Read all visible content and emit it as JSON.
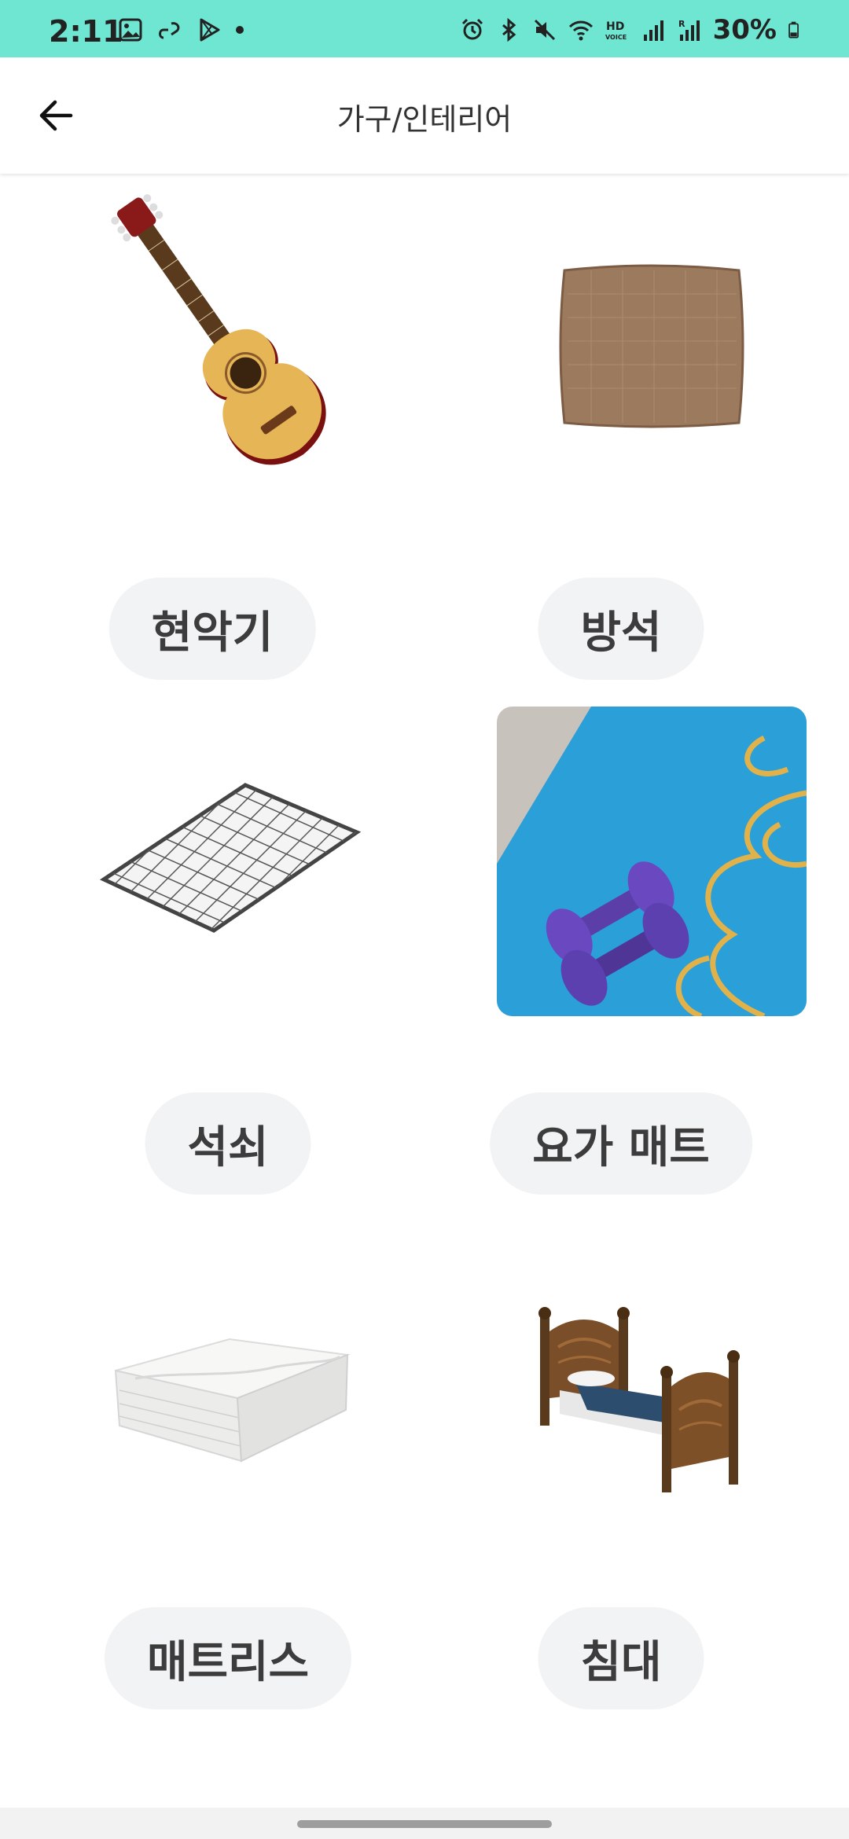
{
  "status_bar": {
    "time": "2:11",
    "battery": "30%",
    "left_icons": [
      "image-icon",
      "link-icon",
      "play-store-icon",
      "notification-dot"
    ],
    "right_icons": [
      "alarm-icon",
      "bluetooth-icon",
      "mute-icon",
      "wifi-icon",
      "hd-voice-icon",
      "signal-icon",
      "signal-r-icon",
      "battery-icon"
    ],
    "bg_color": "#6ee6d2"
  },
  "app_bar": {
    "title": "가구/인테리어",
    "back_icon": "arrow-left-icon"
  },
  "items": [
    {
      "label": "현악기",
      "image": "guitar"
    },
    {
      "label": "방석",
      "image": "cushion"
    },
    {
      "label": "석쇠",
      "image": "grill-grate"
    },
    {
      "label": "요가 매트",
      "image": "yoga-mat-with-dumbbells"
    },
    {
      "label": "매트리스",
      "image": "mattress"
    },
    {
      "label": "침대",
      "image": "bed"
    }
  ]
}
